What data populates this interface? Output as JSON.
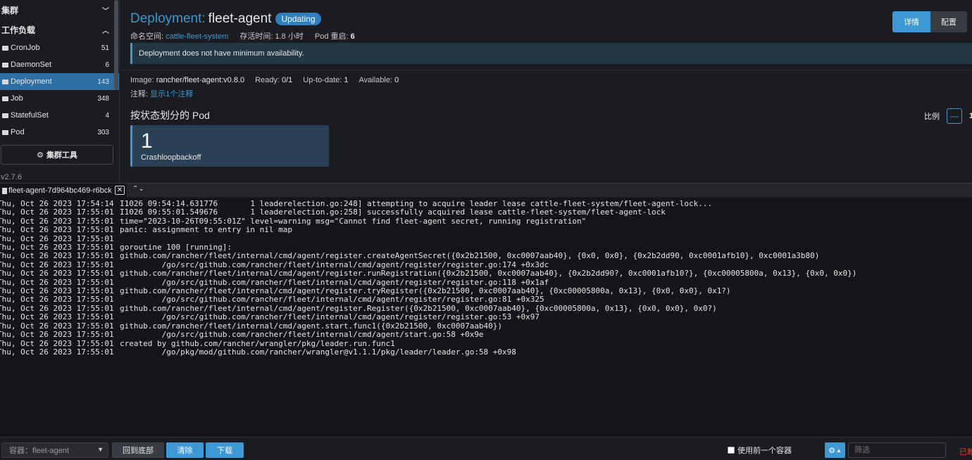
{
  "sidebar": {
    "cluster_label": "集群",
    "workloads_label": "工作负载",
    "items": [
      {
        "label": "CronJob",
        "count": "51"
      },
      {
        "label": "DaemonSet",
        "count": "6"
      },
      {
        "label": "Deployment",
        "count": "143"
      },
      {
        "label": "Job",
        "count": "348"
      },
      {
        "label": "StatefulSet",
        "count": "4"
      },
      {
        "label": "Pod",
        "count": "303"
      }
    ],
    "cluster_tools": "集群工具",
    "version": "v2.7.6"
  },
  "header": {
    "kind": "Deployment:",
    "name": "fleet-agent",
    "badge": "Updating",
    "namespace_label": "命名空间:",
    "namespace": "cattle-fleet-system",
    "age_label": "存活时间:",
    "age": "1.8 小时",
    "restarts_label": "Pod 重启:",
    "restarts": "6",
    "btn_detail": "详情",
    "btn_config": "配置"
  },
  "banner": "Deployment does not have minimum availability.",
  "stats": {
    "image_label": "Image:",
    "image": "rancher/fleet-agent:v0.8.0",
    "ready_label": "Ready:",
    "ready": "0/1",
    "uptodate_label": "Up-to-date:",
    "uptodate": "1",
    "available_label": "Available:",
    "available": "0",
    "annot_label": "注释:",
    "annot_link": "显示1个注释"
  },
  "pods": {
    "title": "按状态划分的 Pod",
    "card_count": "1",
    "card_label": "Crashloopbackoff",
    "scale_label": "比例",
    "scale_minus": "—",
    "scale_value": "1"
  },
  "log": {
    "tab_title": "fleet-agent-7d964bc469-r6bck",
    "close": "✕",
    "expand": "❮❯",
    "lines": [
      {
        "ts": "Thu, Oct 26 2023 17:54:14",
        "msg": "I1026 09:54:14.631776       1 leaderelection.go:248] attempting to acquire leader lease cattle-fleet-system/fleet-agent-lock..."
      },
      {
        "ts": "Thu, Oct 26 2023 17:55:01",
        "msg": "I1026 09:55:01.549676       1 leaderelection.go:258] successfully acquired lease cattle-fleet-system/fleet-agent-lock"
      },
      {
        "ts": "Thu, Oct 26 2023 17:55:01",
        "msg": "time=\"2023-10-26T09:55:01Z\" level=warning msg=\"Cannot find fleet-agent secret, running registration\""
      },
      {
        "ts": "Thu, Oct 26 2023 17:55:01",
        "msg": "panic: assignment to entry in nil map"
      },
      {
        "ts": "Thu, Oct 26 2023 17:55:01",
        "msg": ""
      },
      {
        "ts": "Thu, Oct 26 2023 17:55:01",
        "msg": "goroutine 100 [running]:"
      },
      {
        "ts": "Thu, Oct 26 2023 17:55:01",
        "msg": "github.com/rancher/fleet/internal/cmd/agent/register.createAgentSecret({0x2b21500, 0xc0007aab40}, {0x0, 0x0}, {0x2b2dd90, 0xc0001afb10}, 0xc0001a3b80)"
      },
      {
        "ts": "Thu, Oct 26 2023 17:55:01",
        "msg": "         /go/src/github.com/rancher/fleet/internal/cmd/agent/register/register.go:174 +0x3dc"
      },
      {
        "ts": "Thu, Oct 26 2023 17:55:01",
        "msg": "github.com/rancher/fleet/internal/cmd/agent/register.runRegistration({0x2b21500, 0xc0007aab40}, {0x2b2dd90?, 0xc0001afb10?}, {0xc00005800a, 0x13}, {0x0, 0x0})"
      },
      {
        "ts": "Thu, Oct 26 2023 17:55:01",
        "msg": "         /go/src/github.com/rancher/fleet/internal/cmd/agent/register/register.go:118 +0x1af"
      },
      {
        "ts": "Thu, Oct 26 2023 17:55:01",
        "msg": "github.com/rancher/fleet/internal/cmd/agent/register.tryRegister({0x2b21500, 0xc0007aab40}, {0xc00005800a, 0x13}, {0x0, 0x0}, 0x1?)"
      },
      {
        "ts": "Thu, Oct 26 2023 17:55:01",
        "msg": "         /go/src/github.com/rancher/fleet/internal/cmd/agent/register/register.go:81 +0x325"
      },
      {
        "ts": "Thu, Oct 26 2023 17:55:01",
        "msg": "github.com/rancher/fleet/internal/cmd/agent/register.Register({0x2b21500, 0xc0007aab40}, {0xc00005800a, 0x13}, {0x0, 0x0}, 0x0?)"
      },
      {
        "ts": "Thu, Oct 26 2023 17:55:01",
        "msg": "         /go/src/github.com/rancher/fleet/internal/cmd/agent/register/register.go:53 +0x97"
      },
      {
        "ts": "Thu, Oct 26 2023 17:55:01",
        "msg": "github.com/rancher/fleet/internal/cmd/agent.start.func1({0x2b21500, 0xc0007aab40})"
      },
      {
        "ts": "Thu, Oct 26 2023 17:55:01",
        "msg": "         /go/src/github.com/rancher/fleet/internal/cmd/agent/start.go:58 +0x9e"
      },
      {
        "ts": "Thu, Oct 26 2023 17:55:01",
        "msg": "created by github.com/rancher/wrangler/pkg/leader.run.func1"
      },
      {
        "ts": "Thu, Oct 26 2023 17:55:01",
        "msg": "         /go/pkg/mod/github.com/rancher/wrangler@v1.1.1/pkg/leader/leader.go:58 +0x98"
      }
    ]
  },
  "footer": {
    "container_select": "容器：fleet-agent",
    "btn_bottom": "回到底部",
    "btn_clear": "清除",
    "btn_download": "下载",
    "prev_container": "使用前一个容器",
    "filter_placeholder": "筛选",
    "status": "已断开"
  },
  "colors": {
    "accent": "#3d98d3",
    "background": "#1b1c21",
    "log_background": "#141519",
    "error": "#e03c31"
  }
}
